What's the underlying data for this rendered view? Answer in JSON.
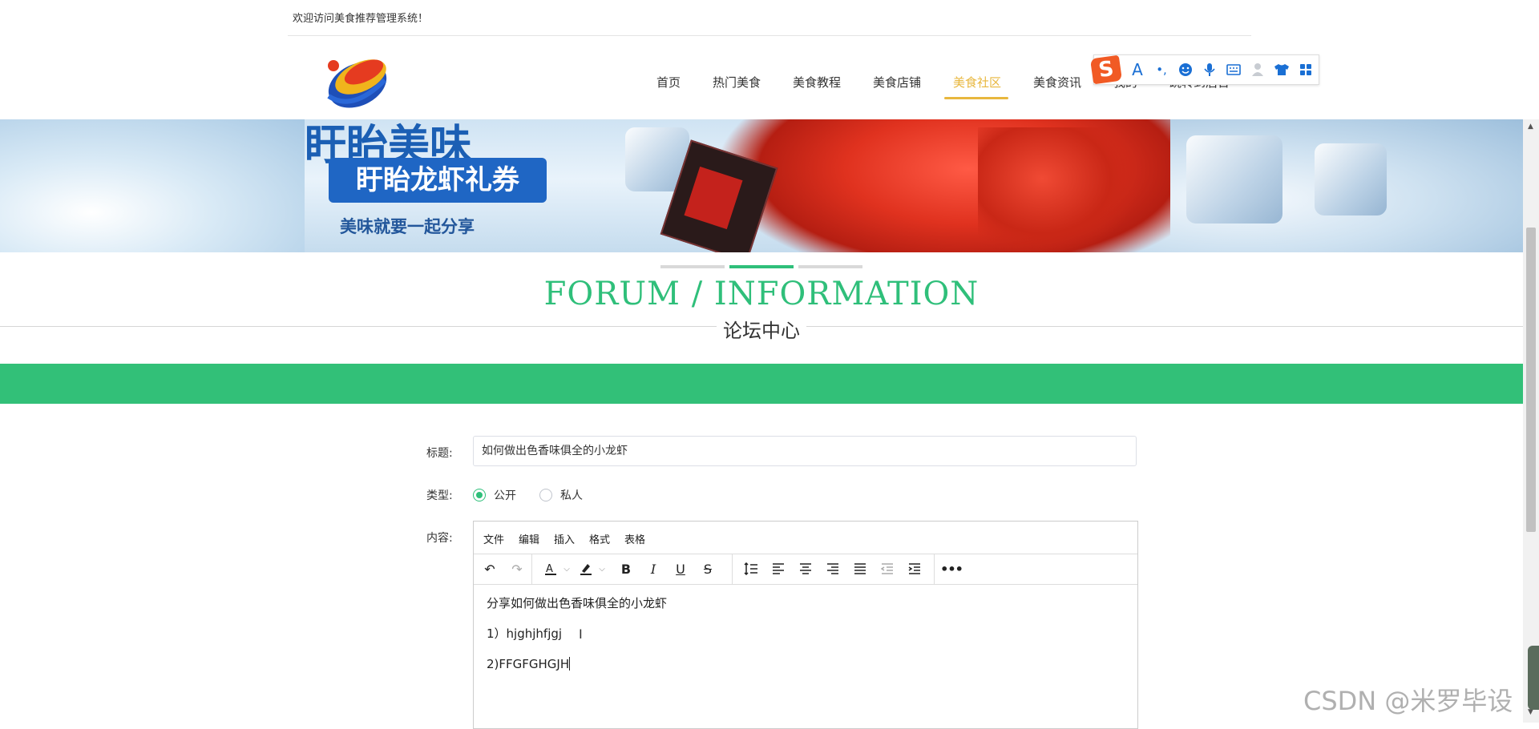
{
  "header": {
    "welcome": "欢迎访问美食推荐管理系统！",
    "nav": [
      {
        "label": "首页"
      },
      {
        "label": "热门美食"
      },
      {
        "label": "美食教程"
      },
      {
        "label": "美食店铺"
      },
      {
        "label": "美食社区",
        "active": true
      },
      {
        "label": "美食资讯"
      },
      {
        "label": "我的"
      },
      {
        "label": "跳转到后台"
      }
    ],
    "accent_color": "#e8b73e"
  },
  "ime": {
    "logo": "S",
    "icons": [
      "font-icon",
      "punctuation-icon",
      "emoji-icon",
      "microphone-icon",
      "keyboard-icon",
      "user-icon",
      "skin-icon",
      "grid-icon"
    ]
  },
  "banner": {
    "title": "盱眙美味",
    "pill": "盱眙龙虾礼券",
    "subtitle": "美味就要一起分享"
  },
  "section": {
    "title_en": "FORUM / INFORMATION",
    "title_cn": "论坛中心",
    "theme_color": "#32c078"
  },
  "form": {
    "title_label": "标题:",
    "title_value": "如何做出色香味俱全的小龙虾",
    "type_label": "类型:",
    "type_options": [
      {
        "label": "公开",
        "checked": true
      },
      {
        "label": "私人",
        "checked": false
      }
    ],
    "content_label": "内容:",
    "editor": {
      "menu": [
        "文件",
        "编辑",
        "插入",
        "格式",
        "表格"
      ],
      "lines": [
        "分享如何做出色香味俱全的小龙虾",
        "1）hjghjhfjgj",
        "2)FFGFGHGJH"
      ]
    }
  },
  "watermark": "CSDN @米罗毕设"
}
